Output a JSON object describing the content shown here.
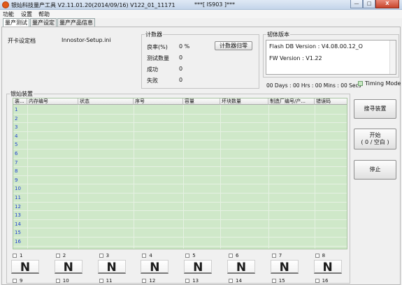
{
  "window": {
    "title": "银灿科技量产工具 V2.11.01.20(2014/09/16)   V122_01_11171",
    "title_mid": "***[ IS903 ]***",
    "buttons": [
      "—",
      "□",
      "X"
    ]
  },
  "menu": [
    "功能",
    "设置",
    "帮助"
  ],
  "tabs": [
    "量产测试",
    "量产设定",
    "量产产品信息"
  ],
  "card_settings": {
    "label": "开卡设定档",
    "value": "Innostor-Setup.ini"
  },
  "counter": {
    "legend": "计数器",
    "rows": [
      {
        "label": "良率(%)",
        "value": "0 %"
      },
      {
        "label": "测试数量",
        "value": "0"
      },
      {
        "label": "成功",
        "value": "0"
      },
      {
        "label": "失败",
        "value": "0"
      }
    ],
    "reset_button": "计数器归零"
  },
  "firmware": {
    "legend": "韧体版本",
    "lines": [
      "Flash DB Version :  V4.08.00.12_O",
      "FW Version :   V1.22"
    ]
  },
  "timer": {
    "text": "00 Days : 00 Hrs : 00 Mins : 00 Secs",
    "timing_mode_label": "Timing Mode"
  },
  "devices": {
    "legend": "银灿装置",
    "columns": [
      "装...",
      "内存编号",
      "状态",
      "序号",
      "容量",
      "坏块数量",
      "制造厂编号/产...",
      "错误码"
    ],
    "rows": [
      "1",
      "2",
      "3",
      "4",
      "5",
      "6",
      "7",
      "8",
      "9",
      "10",
      "11",
      "12",
      "13",
      "14",
      "15",
      "16"
    ]
  },
  "actions": {
    "scan": "搜寻装置",
    "start": "开始\n( 0 / 空白 )",
    "stop": "停止"
  },
  "slots": {
    "row1": [
      "1",
      "2",
      "3",
      "4",
      "5",
      "6",
      "7",
      "8"
    ],
    "row2": [
      "9",
      "10",
      "11",
      "12",
      "13",
      "14",
      "15",
      "16"
    ],
    "state": "N"
  },
  "colors": {
    "grid": "#cfe8c9",
    "row_number": "#1e3fd0",
    "accent": "#e05a1a"
  }
}
